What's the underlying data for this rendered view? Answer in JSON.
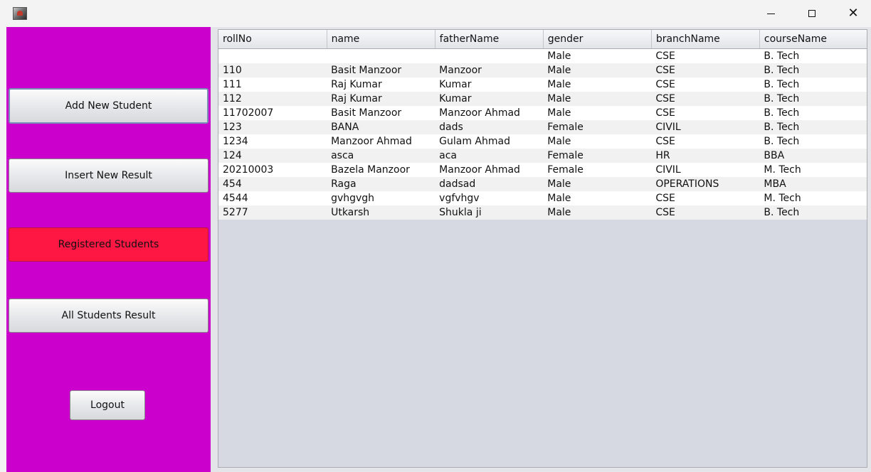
{
  "sidebar": {
    "buttons": {
      "add_new_student": "Add New Student",
      "insert_new_result": "Insert New Result",
      "registered_students": "Registered Students",
      "all_students_result": "All Students Result",
      "logout": "Logout"
    },
    "background_color": "#cc00cc",
    "active_button_color": "#ff1744"
  },
  "titlebar": {
    "icons": [
      "app-icon",
      "minimize-icon",
      "maximize-icon",
      "close-icon"
    ]
  },
  "table": {
    "columns": [
      "rollNo",
      "name",
      "fatherName",
      "gender",
      "branchName",
      "courseName"
    ],
    "rows": [
      [
        "",
        "",
        "",
        "Male",
        "CSE",
        "B. Tech"
      ],
      [
        "110",
        "Basit Manzoor",
        "Manzoor",
        "Male",
        "CSE",
        "B. Tech"
      ],
      [
        "111",
        "Raj Kumar",
        "Kumar",
        "Male",
        "CSE",
        "B. Tech"
      ],
      [
        "112",
        "Raj Kumar",
        "Kumar",
        "Male",
        "CSE",
        "B. Tech"
      ],
      [
        "11702007",
        "Basit Manzoor",
        "Manzoor Ahmad",
        "Male",
        "CSE",
        "B. Tech"
      ],
      [
        "123",
        "BANA",
        "dads",
        "Female",
        "CIVIL",
        "B. Tech"
      ],
      [
        "1234",
        "Manzoor Ahmad",
        "Gulam Ahmad",
        "Male",
        "CSE",
        "B. Tech"
      ],
      [
        "124",
        "asca",
        "aca",
        "Female",
        "HR",
        "BBA"
      ],
      [
        "20210003",
        "Bazela Manzoor",
        "Manzoor Ahmad",
        "Female",
        "CIVIL",
        "M. Tech"
      ],
      [
        "454",
        "Raga",
        "dadsad",
        "Male",
        "OPERATIONS",
        "MBA"
      ],
      [
        "4544",
        "gvhgvgh",
        "vgfvhgv",
        "Male",
        "CSE",
        "M. Tech"
      ],
      [
        "5277",
        "Utkarsh",
        "Shukla ji",
        "Male",
        "CSE",
        "B. Tech"
      ]
    ]
  }
}
